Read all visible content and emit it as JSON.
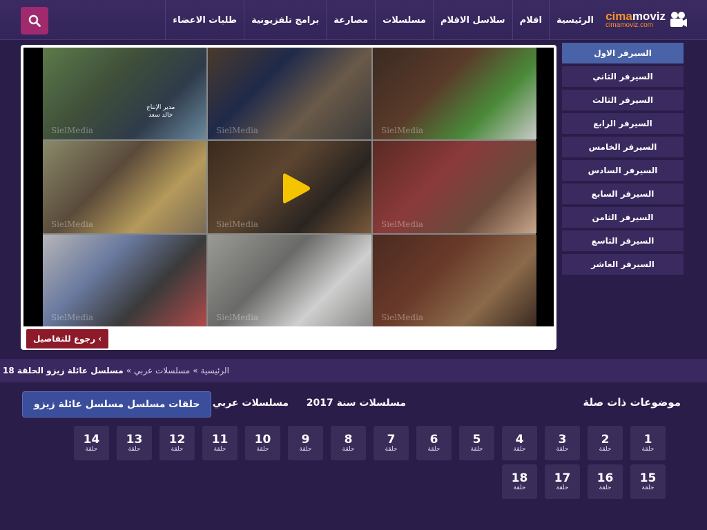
{
  "header": {
    "logo_main_prefix": "cima",
    "logo_main_suffix": "moviz",
    "logo_sub": "cimamoviz.com",
    "nav": [
      "الرئيسية",
      "افلام",
      "سلاسل الافلام",
      "مسلسلات",
      "مصارعة",
      "برامج تلفزيونية",
      "طلبات الاعضاء"
    ]
  },
  "player": {
    "watermark": "SielMedia",
    "overlay_text_line1": "مدير الإنتاج",
    "overlay_text_line2": "خالد سعد",
    "back_label": "رجوع للتفاصيل ‹"
  },
  "servers": [
    "السيرفر الاول",
    "السيرفر الثاني",
    "السيرفر الثالث",
    "السيرفر الرابع",
    "السيرفر الخامس",
    "السيرفر السادس",
    "السيرفر السابع",
    "السيرفر الثامن",
    "السيرفر التاسع",
    "السيرفر العاشر"
  ],
  "breadcrumb": {
    "home": "الرئيسية",
    "sep": "»",
    "category": "مسلسلات عربي",
    "current": "مسلسل عائلة زيزو الحلقة 18"
  },
  "related": {
    "title": "موضوعات ذات صلة",
    "tag_year": "مسلسلات سنة 2017",
    "tag_arabic": "مسلسلات عربي",
    "tag_episodes": "حلقات مسلسل مسلسل عائلة زيزو"
  },
  "episodes": {
    "label": "حلقة",
    "numbers": [
      "1",
      "2",
      "3",
      "4",
      "5",
      "6",
      "7",
      "8",
      "9",
      "10",
      "11",
      "12",
      "13",
      "14",
      "15",
      "16",
      "17",
      "18"
    ]
  },
  "colors": {
    "background": "#2b1d4a",
    "accent_search": "#a02a6e",
    "active_server": "#4a62a8",
    "back_button": "#8c1a2a",
    "logo_orange": "#f7932a"
  }
}
